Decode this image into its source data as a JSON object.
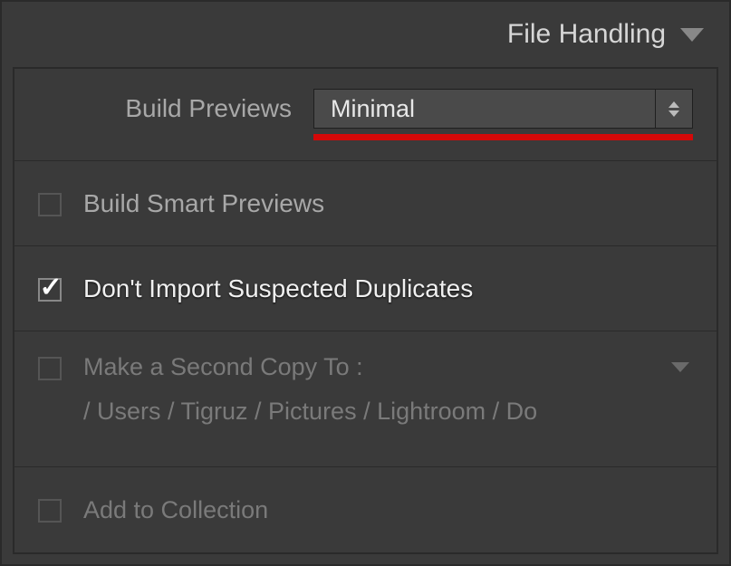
{
  "header": {
    "title": "File Handling"
  },
  "buildPreviews": {
    "label": "Build Previews",
    "value": "Minimal"
  },
  "options": {
    "buildSmart": {
      "label": "Build Smart Previews",
      "checked": false
    },
    "noDuplicates": {
      "label": "Don't Import Suspected Duplicates",
      "checked": true
    },
    "secondCopy": {
      "label": "Make a Second Copy To :",
      "checked": false,
      "path": "/ Users / Tigruz / Pictures / Lightroom / Do"
    },
    "addCollection": {
      "label": "Add to Collection",
      "checked": false
    }
  },
  "colors": {
    "highlight": "#d40808"
  }
}
